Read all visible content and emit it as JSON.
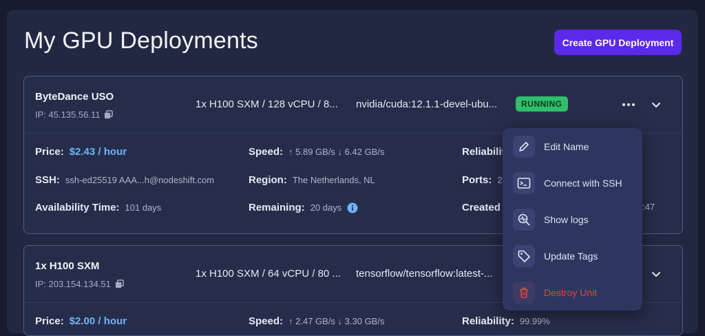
{
  "page": {
    "title": "My GPU Deployments",
    "create_label": "Create GPU Deployment"
  },
  "deployments": [
    {
      "name": "ByteDance USO",
      "ip": "IP: 45.135.56.11",
      "spec": "1x H100 SXM / 128 vCPU / 8...",
      "image": "nvidia/cuda:12.1.1-devel-ubu...",
      "status": "RUNNING",
      "details": {
        "price_label": "Price:",
        "price_value": "$2.43 / hour",
        "speed_label": "Speed:",
        "speed_value": "↑ 5.89 GB/s ↓ 6.42 GB/s",
        "reliability_label": "Reliabilit",
        "ssh_label": "SSH:",
        "ssh_value": "ssh-ed25519 AAA...h@nodeshift.com",
        "region_label": "Region:",
        "region_value": "The Netherlands, NL",
        "ports_label": "Ports:",
        "ports_value": "2",
        "availability_label": "Availability Time:",
        "availability_value": "101 days",
        "remaining_label": "Remaining:",
        "remaining_value": "20 days",
        "created_label": "Created",
        "created_value": ":47"
      }
    },
    {
      "name": "1x H100 SXM",
      "ip": "IP: 203.154.134.51",
      "spec": "1x H100 SXM / 64 vCPU / 80 ...",
      "image": "tensorflow/tensorflow:latest-...",
      "details": {
        "price_label": "Price:",
        "price_value": "$2.00 / hour",
        "speed_label": "Speed:",
        "speed_value": "↑ 2.47 GB/s ↓ 3.30 GB/s",
        "reliability_label": "Reliability:",
        "reliability_value": "99.99%"
      }
    }
  ],
  "menu": {
    "items": [
      {
        "label": "Edit Name",
        "icon": "pencil-icon"
      },
      {
        "label": "Connect with SSH",
        "icon": "terminal-icon"
      },
      {
        "label": "Show logs",
        "icon": "logs-search-icon"
      },
      {
        "label": "Update Tags",
        "icon": "tag-icon"
      },
      {
        "label": "Destroy Unit",
        "icon": "trash-icon",
        "danger": true
      }
    ]
  },
  "colors": {
    "background": "#161b2e",
    "panel": "#222841",
    "accent": "#5b29e8",
    "running": "#2fbf6a",
    "price": "#6fb3f5",
    "danger": "#e0463c"
  }
}
